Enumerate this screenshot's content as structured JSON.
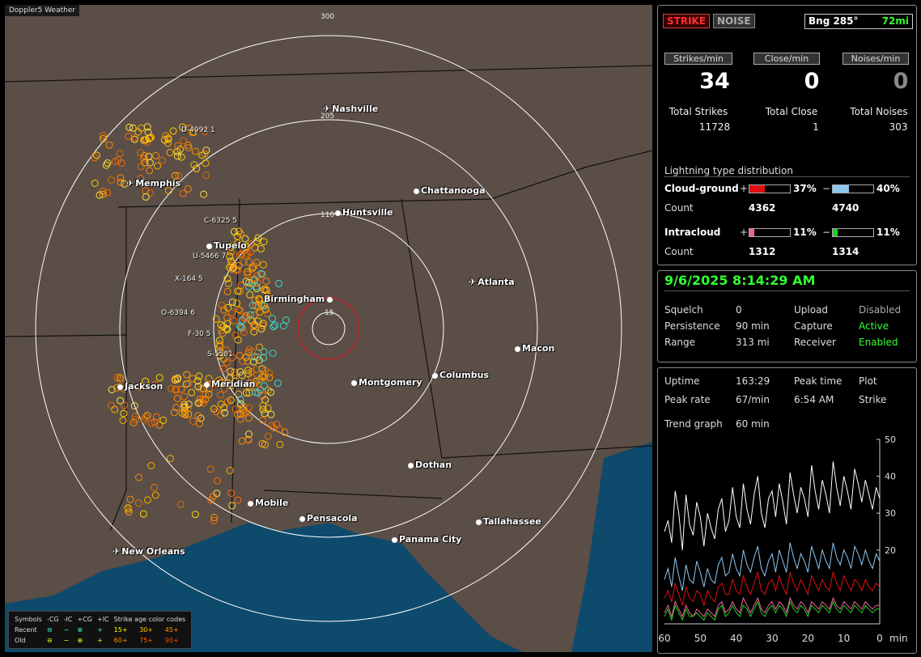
{
  "app_title": "Doppler5 Weather",
  "map": {
    "cities": [
      {
        "name": "Nashville",
        "icon": "airport"
      },
      {
        "name": "Memphis",
        "icon": "airport"
      },
      {
        "name": "Chattanooga",
        "icon": "dot"
      },
      {
        "name": "Huntsville",
        "icon": "dot"
      },
      {
        "name": "Tupelo",
        "icon": "dot"
      },
      {
        "name": "Birmingham",
        "icon": "dot"
      },
      {
        "name": "Atlanta",
        "icon": "airport"
      },
      {
        "name": "Macon",
        "icon": "dot"
      },
      {
        "name": "Jackson",
        "icon": "dot"
      },
      {
        "name": "Meridian",
        "icon": "dot"
      },
      {
        "name": "Montgomery",
        "icon": "dot"
      },
      {
        "name": "Columbus",
        "icon": "dot"
      },
      {
        "name": "Dothan",
        "icon": "dot"
      },
      {
        "name": "Mobile",
        "icon": "dot"
      },
      {
        "name": "Pensacola",
        "icon": "dot"
      },
      {
        "name": "Tallahassee",
        "icon": "dot"
      },
      {
        "name": "Panama City",
        "icon": "dot"
      },
      {
        "name": "New Orleans",
        "icon": "airport"
      }
    ],
    "ring_labels": [
      "300",
      "205",
      "110",
      "15"
    ],
    "storm_labels": [
      "D-4992 1",
      "C-6325 5",
      "U-5466 7",
      "X-164 5",
      "O-6394 6",
      "F-30 5",
      "S-5581"
    ],
    "colors": {
      "land": "#5a4e47",
      "water": "#0e4a6b",
      "rings": "#ffffff",
      "center_circle": "#cc2222"
    }
  },
  "legend": {
    "symbols_label": "Symbols",
    "headers": [
      "-CG",
      "-IC",
      "+CG",
      "+IC"
    ],
    "recent_label": "Recent",
    "old_label": "Old",
    "age_title": "Strike age color codes",
    "age_recent": [
      "15+",
      "30+",
      "45+"
    ],
    "age_old": [
      "60+",
      "75+",
      "90+"
    ]
  },
  "status": {
    "strike_btn": "STRIKE",
    "noise_btn": "NOISE",
    "bearing": "Bng 285°",
    "distance": "72mi",
    "strikes_per_min_label": "Strikes/min",
    "close_per_min_label": "Close/min",
    "noises_per_min_label": "Noises/min",
    "strikes_per_min": "34",
    "close_per_min": "0",
    "noises_per_min": "0",
    "total_strikes_label": "Total Strikes",
    "total_close_label": "Total Close",
    "total_noises_label": "Total Noises",
    "total_strikes": "11728",
    "total_close": "1",
    "total_noises": "303"
  },
  "distribution": {
    "title": "Lightning type distribution",
    "cg_label": "Cloud-ground",
    "ic_label": "Intracloud",
    "count_label": "Count",
    "plus": "+",
    "minus": "−",
    "cg_pos_pct": "37%",
    "cg_neg_pct": "40%",
    "cg_pos_count": "4362",
    "cg_neg_count": "4740",
    "ic_pos_pct": "11%",
    "ic_neg_pct": "11%",
    "ic_pos_count": "1312",
    "ic_neg_count": "1314",
    "bars": {
      "cg_pos": 0.37,
      "cg_neg": 0.4,
      "ic_pos": 0.11,
      "ic_neg": 0.11
    },
    "colors": {
      "cg_pos": "#e01010",
      "cg_neg": "#8ec8f0",
      "ic_pos": "#f060a0",
      "ic_neg": "#20d020"
    }
  },
  "settings": {
    "datetime": "9/6/2025 8:14:29 AM",
    "squelch_label": "Squelch",
    "squelch": "0",
    "persistence_label": "Persistence",
    "persistence": "90 min",
    "range_label": "Range",
    "range": "313 mi",
    "upload_label": "Upload",
    "upload": "Disabled",
    "capture_label": "Capture",
    "capture": "Active",
    "receiver_label": "Receiver",
    "receiver": "Enabled"
  },
  "stats": {
    "uptime_label": "Uptime",
    "uptime": "163:29",
    "peak_time_label": "Peak time",
    "peak_time": "6:54 AM",
    "plot_label": "Plot",
    "plot": "Strike",
    "peak_rate_label": "Peak rate",
    "peak_rate": "67/min",
    "trend_label": "Trend graph",
    "trend": "60 min"
  },
  "chart_data": {
    "type": "line",
    "x_ticks": [
      "60",
      "50",
      "40",
      "30",
      "20",
      "10",
      "0"
    ],
    "x_unit": "min",
    "y_ticks": [
      "50",
      "40",
      "30",
      "20"
    ],
    "ylim": [
      0,
      50
    ],
    "xlim": [
      60,
      0
    ],
    "series": [
      {
        "color": "#ffffff",
        "values": [
          25,
          28,
          22,
          36,
          30,
          20,
          35,
          27,
          24,
          33,
          29,
          21,
          30,
          26,
          23,
          31,
          34,
          25,
          28,
          37,
          29,
          26,
          38,
          31,
          27,
          35,
          40,
          30,
          26,
          34,
          36,
          29,
          38,
          33,
          27,
          41,
          35,
          30,
          37,
          34,
          29,
          43,
          36,
          31,
          39,
          35,
          30,
          44,
          37,
          32,
          40,
          36,
          31,
          42,
          38,
          33,
          39,
          35,
          31,
          37,
          34
        ]
      },
      {
        "color": "#8ec8f0",
        "values": [
          12,
          15,
          10,
          18,
          13,
          9,
          16,
          12,
          11,
          17,
          14,
          10,
          15,
          12,
          11,
          16,
          18,
          13,
          14,
          19,
          15,
          13,
          20,
          16,
          14,
          18,
          21,
          15,
          13,
          17,
          19,
          14,
          20,
          17,
          14,
          22,
          18,
          15,
          19,
          17,
          14,
          21,
          18,
          15,
          20,
          17,
          15,
          22,
          18,
          16,
          20,
          18,
          15,
          21,
          19,
          16,
          20,
          17,
          15,
          19,
          17
        ]
      },
      {
        "color": "#e01010",
        "values": [
          7,
          9,
          6,
          11,
          8,
          5,
          10,
          7,
          6,
          9,
          8,
          5,
          9,
          7,
          6,
          10,
          11,
          8,
          8,
          12,
          9,
          8,
          13,
          10,
          8,
          11,
          14,
          9,
          8,
          11,
          12,
          9,
          13,
          10,
          8,
          14,
          11,
          9,
          12,
          10,
          8,
          13,
          11,
          9,
          12,
          10,
          9,
          14,
          11,
          9,
          13,
          11,
          9,
          12,
          11,
          9,
          12,
          10,
          9,
          11,
          10
        ]
      },
      {
        "color": "#f060a0",
        "values": [
          3,
          5,
          2,
          6,
          4,
          2,
          5,
          3,
          2,
          4,
          3,
          2,
          4,
          3,
          2,
          5,
          6,
          3,
          4,
          6,
          4,
          3,
          7,
          5,
          3,
          5,
          7,
          4,
          3,
          5,
          6,
          4,
          6,
          5,
          3,
          7,
          5,
          4,
          6,
          5,
          3,
          6,
          5,
          4,
          6,
          5,
          4,
          7,
          5,
          4,
          6,
          5,
          4,
          6,
          5,
          4,
          6,
          5,
          4,
          5,
          5
        ]
      },
      {
        "color": "#20d020",
        "values": [
          2,
          4,
          1,
          5,
          3,
          1,
          4,
          2,
          2,
          3,
          2,
          1,
          3,
          2,
          1,
          4,
          5,
          2,
          3,
          5,
          3,
          2,
          5,
          4,
          2,
          4,
          6,
          3,
          2,
          4,
          5,
          3,
          5,
          4,
          2,
          6,
          4,
          3,
          5,
          4,
          2,
          5,
          4,
          3,
          5,
          4,
          3,
          6,
          4,
          3,
          5,
          4,
          3,
          5,
          4,
          3,
          5,
          4,
          3,
          4,
          4
        ]
      }
    ]
  }
}
